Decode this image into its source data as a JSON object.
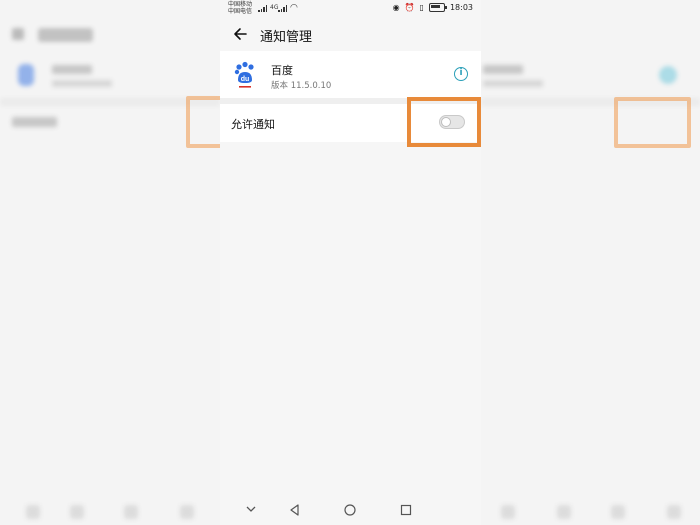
{
  "status_bar": {
    "carrier_1": "中国移动",
    "carrier_2": "中国电信",
    "network": "4G",
    "time": "18:03"
  },
  "header": {
    "title": "通知管理"
  },
  "app": {
    "name": "百度",
    "version": "版本 11.5.0.10"
  },
  "settings": {
    "allow_notifications_label": "允许通知",
    "allow_notifications_on": false
  },
  "icons": {
    "back": "back-arrow-icon",
    "info": "info-icon",
    "nav": [
      "chevron-down-icon",
      "nav-back-icon",
      "nav-home-icon",
      "nav-recent-icon"
    ]
  },
  "colors": {
    "highlight": "#e88a3a",
    "info_accent": "#2a9fb8",
    "app_icon_blue": "#2f6ee0",
    "app_icon_red": "#d93025"
  }
}
